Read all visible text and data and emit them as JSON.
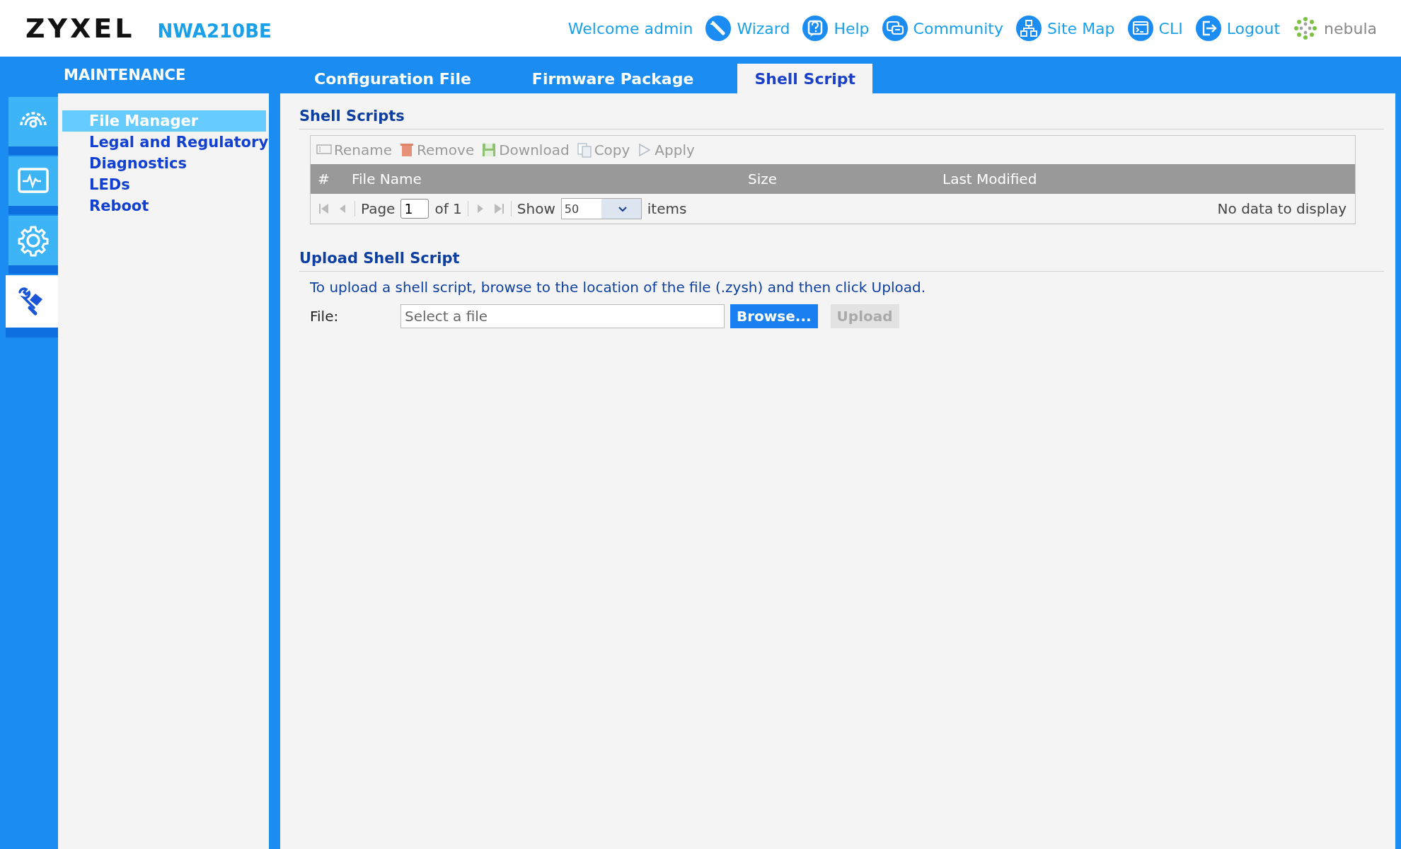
{
  "header": {
    "logo": "ZYXEL",
    "model": "NWA210BE",
    "welcome": "Welcome admin",
    "links": [
      {
        "kind": "wizard",
        "label": "Wizard"
      },
      {
        "kind": "help",
        "label": "Help"
      },
      {
        "kind": "community",
        "label": "Community"
      },
      {
        "kind": "sitemap",
        "label": "Site Map"
      },
      {
        "kind": "cli",
        "label": "CLI"
      },
      {
        "kind": "logout",
        "label": "Logout"
      },
      {
        "kind": "nebula",
        "label": "nebula"
      }
    ]
  },
  "section_title": "MAINTENANCE",
  "tabs": [
    {
      "label": "Configuration File",
      "selected": false
    },
    {
      "label": "Firmware Package",
      "selected": false
    },
    {
      "label": "Shell Script",
      "selected": true
    }
  ],
  "rail": [
    {
      "kind": "dashboard",
      "selected": false
    },
    {
      "kind": "monitor",
      "selected": false
    },
    {
      "kind": "settings",
      "selected": false
    },
    {
      "kind": "maintenance",
      "selected": true
    }
  ],
  "menu": [
    {
      "label": "File Manager",
      "selected": true
    },
    {
      "label": "Legal and Regulatory",
      "selected": false
    },
    {
      "label": "Diagnostics",
      "selected": false
    },
    {
      "label": "LEDs",
      "selected": false
    },
    {
      "label": "Reboot",
      "selected": false
    }
  ],
  "shell_scripts": {
    "title": "Shell Scripts",
    "toolbar": [
      {
        "kind": "rename",
        "label": "Rename",
        "disabled": true
      },
      {
        "kind": "remove",
        "label": "Remove",
        "disabled": true
      },
      {
        "kind": "download",
        "label": "Download",
        "disabled": true
      },
      {
        "kind": "copy",
        "label": "Copy",
        "disabled": true
      },
      {
        "kind": "apply",
        "label": "Apply",
        "disabled": true
      }
    ],
    "columns": [
      "#",
      "File Name",
      "Size",
      "Last Modified"
    ],
    "pager": {
      "page_label": "Page",
      "page": "1",
      "of": "of 1",
      "show": "Show",
      "per_page": "50",
      "items": "items",
      "status": "No data to display"
    }
  },
  "upload": {
    "title": "Upload Shell Script",
    "instruction": "To upload a shell script, browse to the location of the file (.zysh) and then click Upload.",
    "file_label": "File:",
    "placeholder": "Select a file",
    "browse": "Browse...",
    "upload": {
      "label": "Upload",
      "disabled": true
    }
  }
}
